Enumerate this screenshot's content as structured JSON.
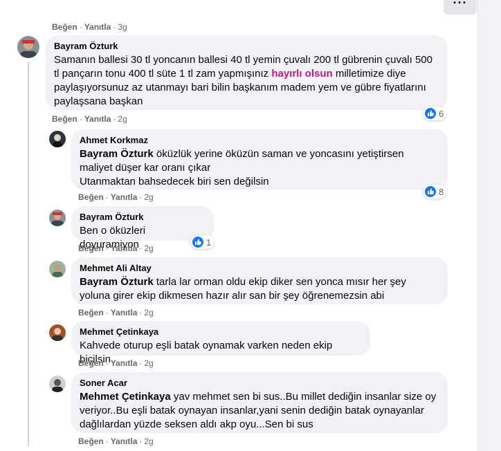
{
  "header": {
    "more_label": "···"
  },
  "actions": {
    "like": "Beğen",
    "reply": "Yanıtla",
    "sep": "·"
  },
  "top_comment_time": "3g",
  "comments": [
    {
      "author": "Bayram Özturk",
      "text_pre": "Samanın ballesi 30 tl yoncanın ballesi 40 tl yemin çuvalı 200 tl gübrenin çuvalı 500 tl pançarın tonu 400 tl süte 1 tl zam yapmışınız ",
      "highlight": "hayırlı olsun",
      "text_post": " milletimize diye paylaşıyorsunuz az utanmayı bari bilin başkanım madem yem ve gübre fiyatlarını paylaşsana başkan",
      "reactions": "6",
      "time": "2g"
    },
    {
      "author": "Ahmet Korkmaz",
      "mention": "Bayram Özturk",
      "text": " öküzlük yerine öküzün saman ve yoncasını yetiştirsen maliyet düşer kar oranı çıkar",
      "text2": "Utanmaktan bahsedecek biri sen değilsin",
      "reactions": "8",
      "time": "2g"
    },
    {
      "author": "Bayram Özturk",
      "text": "Ben o öküzleri doyuramiyon",
      "reactions": "1",
      "time": "2g"
    },
    {
      "author": "Mehmet Ali Altay",
      "mention": "Bayram Özturk",
      "text": " tarla lar orman oldu ekip diker sen yonca mısır her şey yoluna girer ekip dikmesen hazır alır san bir şey öğrenemezsin abi",
      "time": "2g"
    },
    {
      "author": "Mehmet Çetinkaya",
      "text": "Kahvede oturup eşli batak oynamak varken neden ekip biçilsin",
      "time": "2g"
    },
    {
      "author": "Soner Acar",
      "mention": "Mehmet Çetinkaya",
      "text": " yav mehmet sen bi sus..Bu millet dediğin insanlar size oy veriyor..Bu eşli batak oynayan insanlar,yani senin dediğin batak oynayanlar dağlılardan yüzde seksen aldı akp oyu...Sen bi sus",
      "time": "2g"
    }
  ]
}
